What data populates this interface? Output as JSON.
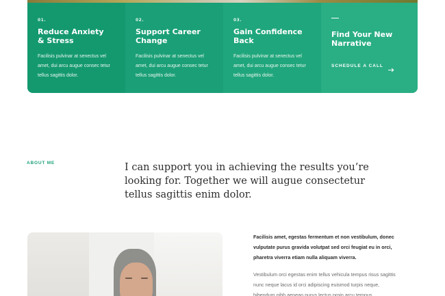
{
  "services": [
    {
      "num": "01.",
      "title_line1": "Reduce Anxiety",
      "title_line2": "& Stress",
      "body": "Facilisis pulvinar at senectus vel amet, dui arcu augue consec tetur tellus sagittis dolor."
    },
    {
      "num": "02.",
      "title_line1": "Support Career",
      "title_line2": "Change",
      "body": "Facilisis pulvinar at senectus vel amet, dui arcu augue consec tetur tellus sagittis dolor."
    },
    {
      "num": "03.",
      "title_line1": "Gain Confidence",
      "title_line2": "Back",
      "body": "Facilisis pulvinar at senectus vel amet, dui arcu augue consec tetur tellus sagittis dolor."
    }
  ],
  "cta": {
    "title_line1": "Find Your New",
    "title_line2": "Narrative",
    "link_label": "SCHEDULE A CALL",
    "icon": "arrow-right-icon"
  },
  "about": {
    "label": "ABOUT ME",
    "heading": "I can support you in achieving the results you’re looking for. Together we will augue consectetur tellus sagittis enim dolor.",
    "paragraph1": "Facilisis amet, egestas fermentum et non vestibulum, donec vulputate purus gravida volutpat sed orci feugiat eu in orci, pharetra viverra etiam nulla aliquam viverra.",
    "paragraph2": "Vestibulum orci egestas enim tellus vehicula tempus risus sagittis nunc neque lacus id orci adipiscing euismod turpis neque, bibendum nibh aenean purus lectus proin arcu tempus"
  },
  "colors": {
    "accent": "#1da07a",
    "heading_text": "#2d2d2d",
    "body_text": "#6b6b6b"
  }
}
